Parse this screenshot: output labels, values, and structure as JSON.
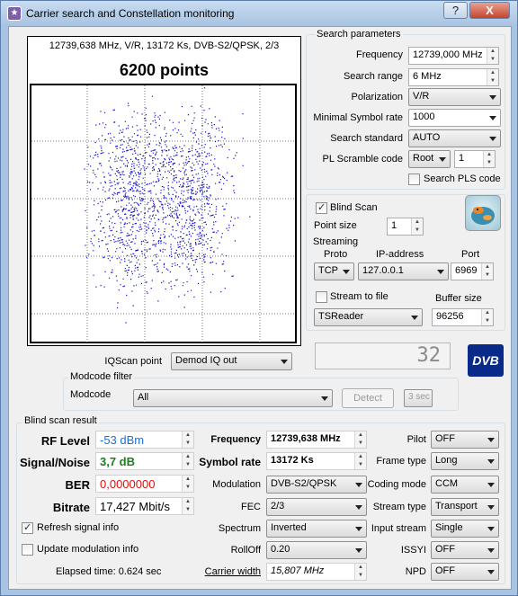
{
  "window": {
    "title": "Carrier search and Constellation monitoring",
    "help_btn": "?",
    "close_btn": "X",
    "icon_glyph": "★"
  },
  "constellation": {
    "info": "12739,638 MHz, V/R, 13172 Ks, DVB-S2/QPSK, 2/3",
    "points_label": "6200 points",
    "dot_color": "#1010c8",
    "point_count": 6200
  },
  "search_params": {
    "legend": "Search parameters",
    "frequency": {
      "label": "Frequency",
      "value": "12739,000 MHz"
    },
    "search_range": {
      "label": "Search range",
      "value": "6 MHz"
    },
    "polarization": {
      "label": "Polarization",
      "value": "V/R"
    },
    "min_symbol_rate": {
      "label": "Minimal Symbol rate",
      "value": "1000"
    },
    "search_standard": {
      "label": "Search standard",
      "value": "AUTO"
    },
    "pl_scramble": {
      "label": "PL Scramble code",
      "mode": "Root",
      "value": "1"
    },
    "search_pls": {
      "label": "Search PLS code",
      "checked": false
    }
  },
  "blind_scan": {
    "label": "Blind Scan",
    "checked": true
  },
  "point_size": {
    "label": "Point size",
    "value": "1"
  },
  "streaming": {
    "label": "Streaming",
    "proto_label": "Proto",
    "proto": "TCP",
    "ip_label": "IP-address",
    "ip": "127.0.0.1",
    "port_label": "Port",
    "port": "6969",
    "stream_to_file": {
      "label": "Stream to file",
      "checked": false
    },
    "buffer_label": "Buffer size",
    "buffer": "96256",
    "target": "TSReader"
  },
  "iq": {
    "label": "IQScan point",
    "value": "Demod IQ out"
  },
  "counter": "32",
  "dvb_logo": "DVB",
  "modcode_filter": {
    "legend": "Modcode filter",
    "label": "Modcode",
    "value": "All",
    "detect": "Detect",
    "interval": "3 sec"
  },
  "result": {
    "legend": "Blind scan result",
    "rf_level": {
      "label": "RF Level",
      "value": "-53 dBm",
      "color": "#1a6fd6"
    },
    "snr": {
      "label": "Signal/Noise",
      "value": "3,7 dB",
      "color": "#1c7d1c"
    },
    "ber": {
      "label": "BER",
      "value": "0,0000000",
      "color": "#e01010"
    },
    "bitrate": {
      "label": "Bitrate",
      "value": "17,427 Mbit/s"
    },
    "refresh": {
      "label": "Refresh signal info",
      "checked": true
    },
    "update_mod": {
      "label": "Update modulation info",
      "checked": false
    },
    "elapsed": "Elapsed time: 0.624 sec",
    "frequency": {
      "label": "Frequency",
      "value": "12739,638 MHz"
    },
    "symbol_rate": {
      "label": "Symbol rate",
      "value": "13172 Ks"
    },
    "modulation": {
      "label": "Modulation",
      "value": "DVB-S2/QPSK"
    },
    "fec": {
      "label": "FEC",
      "value": "2/3"
    },
    "spectrum": {
      "label": "Spectrum",
      "value": "Inverted"
    },
    "rolloff": {
      "label": "RollOff",
      "value": "0.20"
    },
    "carrier_width": {
      "label": "Carrier width",
      "value": "15,807 MHz"
    },
    "pilot": {
      "label": "Pilot",
      "value": "OFF"
    },
    "frame_type": {
      "label": "Frame type",
      "value": "Long"
    },
    "coding_mode": {
      "label": "Coding mode",
      "value": "CCM"
    },
    "stream_type": {
      "label": "Stream type",
      "value": "Transport"
    },
    "input_stream": {
      "label": "Input stream",
      "value": "Single"
    },
    "issyi": {
      "label": "ISSYI",
      "value": "OFF"
    },
    "npd": {
      "label": "NPD",
      "value": "OFF"
    }
  }
}
